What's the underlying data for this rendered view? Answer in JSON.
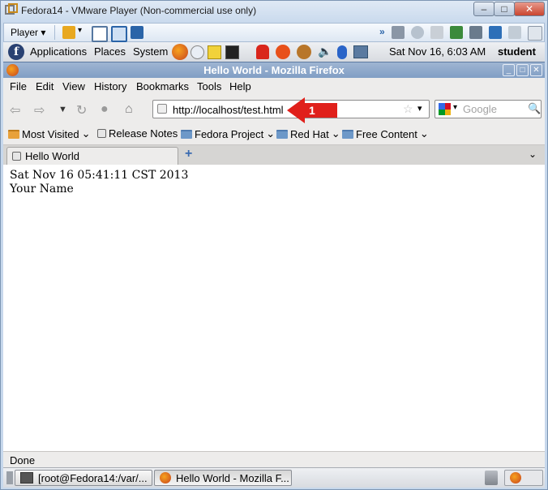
{
  "vmware": {
    "title": "Fedora14 - VMware Player (Non-commercial use only)",
    "player_menu": "Player"
  },
  "panel": {
    "applications": "Applications",
    "places": "Places",
    "system": "System",
    "clock": "Sat Nov 16,  6:03 AM",
    "user": "student"
  },
  "firefox": {
    "window_title": "Hello World - Mozilla Firefox",
    "menu": [
      "File",
      "Edit",
      "View",
      "History",
      "Bookmarks",
      "Tools",
      "Help"
    ],
    "url": "http://localhost/test.html",
    "search_placeholder": "Google",
    "bookmarks": [
      "Most Visited",
      "Release Notes",
      "Fedora Project",
      "Red Hat",
      "Free Content"
    ],
    "tab_title": "Hello World",
    "status": "Done"
  },
  "page": {
    "line1": "Sat Nov 16 05:41:11 CST 2013",
    "line2": "Your Name"
  },
  "taskbar": {
    "terminal": "[root@Fedora14:/var/...",
    "firefox": "Hello World - Mozilla F..."
  },
  "annotation": {
    "number": "1",
    "color": "#e0201b"
  }
}
